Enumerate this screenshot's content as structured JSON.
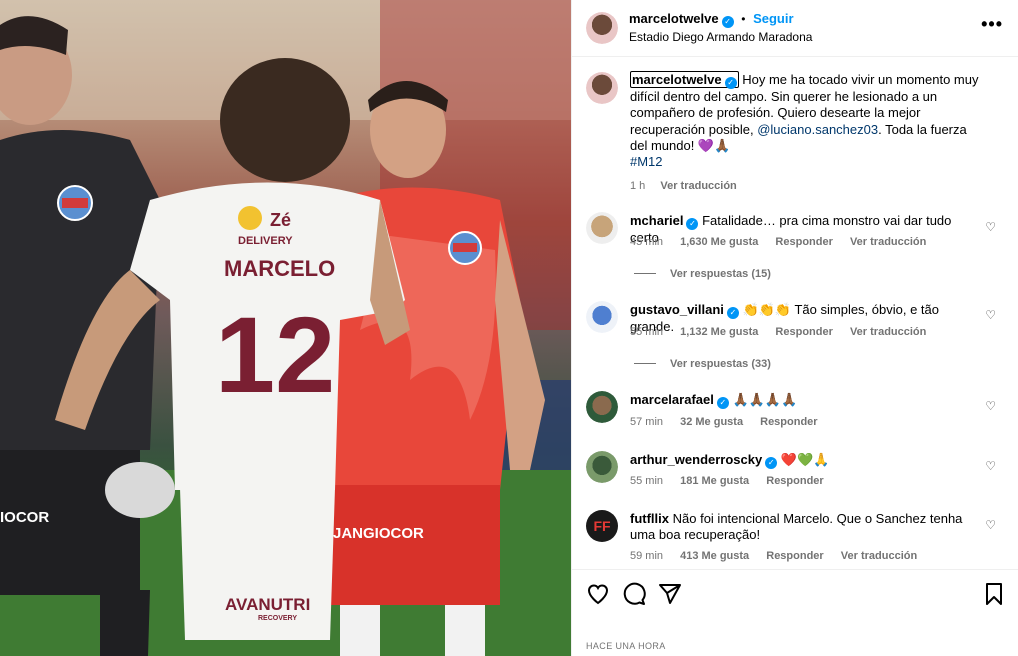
{
  "post": {
    "author": "marcelotwelve",
    "follow_label": "Seguir",
    "location": "Estadio Diego Armando Maradona",
    "more_label": "•••"
  },
  "caption": {
    "username": "marcelotwelve",
    "text_before_mention": " Hoy me ha tocado vivir un momento muy difícil dentro del campo. Sin querer he lesionado a un compañero de profesión. Quiero desearte la mejor recuperación posible, ",
    "mention": "@luciano.sanchez03",
    "text_after_mention": ". Toda la fuerza del mundo! 💜🙏🏾",
    "hashtag": "#M12",
    "time": "1 h",
    "translate_label": "Ver traducción"
  },
  "comments": [
    {
      "username": "mchariel",
      "verified": true,
      "text": "Fatalidade… pra cima monstro vai dar tudo certo",
      "time": "45 min",
      "likes": "1,630 Me gusta",
      "reply_label": "Responder",
      "translate_label": "Ver traducción",
      "view_replies": "Ver respuestas (15)"
    },
    {
      "username": "gustavo_villani",
      "verified": true,
      "text": "👏👏👏 Tão simples, óbvio, e tão grande.",
      "time": "55 min",
      "likes": "1,132 Me gusta",
      "reply_label": "Responder",
      "translate_label": "Ver traducción",
      "view_replies": "Ver respuestas (33)"
    },
    {
      "username": "marcelarafael",
      "verified": true,
      "text": "🙏🏾🙏🏾🙏🏾🙏🏾",
      "time": "57 min",
      "likes": "32 Me gusta",
      "reply_label": "Responder"
    },
    {
      "username": "arthur_wenderroscky",
      "verified": true,
      "text": "❤️💚🙏",
      "time": "55 min",
      "likes": "181 Me gusta",
      "reply_label": "Responder"
    },
    {
      "username": "futfllix",
      "verified": false,
      "text": "Não foi intencional Marcelo. Que o Sanchez tenha uma boa recuperação!",
      "time": "59 min",
      "likes": "413 Me gusta",
      "reply_label": "Responder",
      "translate_label": "Ver traducción"
    }
  ],
  "footer": {
    "timestamp": "HACE UNA HORA"
  },
  "colors": {
    "accent": "#0095f6",
    "link": "#00376b",
    "muted": "#737373"
  },
  "photo": {
    "jersey_name": "MARCELO",
    "jersey_number": "12",
    "sponsor_top": "Zé",
    "sponsor_bottom": "DELIVERY",
    "shorts_text": "AVANUTRI",
    "shorts_sub": "RECOVERY",
    "red_shorts_text": "JANGIOCOR",
    "gk_text": "IOCOR"
  },
  "icons": [
    "verified-icon",
    "more-icon",
    "heart-icon",
    "comment-icon",
    "share-icon",
    "bookmark-icon"
  ]
}
